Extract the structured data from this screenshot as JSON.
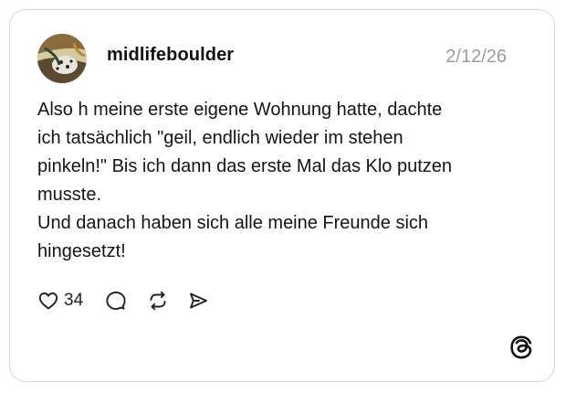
{
  "post": {
    "username": "midlifeboulder",
    "date": "2/12/26",
    "text_lines": [
      "Also h meine erste eigene Wohnung hatte, dachte",
      "ich tatsächlich \"geil, endlich wieder im stehen",
      "pinkeln!\" Bis ich dann das erste Mal das Klo putzen",
      "musste.",
      "Und danach haben sich alle meine Freunde sich",
      "hingesetzt!"
    ],
    "avatar_icon": "avatar",
    "actions": {
      "like_icon": "heart-icon",
      "like_count": "34",
      "comment_icon": "comment-icon",
      "repost_icon": "repost-icon",
      "share_icon": "share-icon"
    },
    "brand_icon": "threads-logo-icon"
  },
  "colors": {
    "border": "#d7d7d7",
    "date": "#9a9a9a",
    "text": "#141414"
  }
}
